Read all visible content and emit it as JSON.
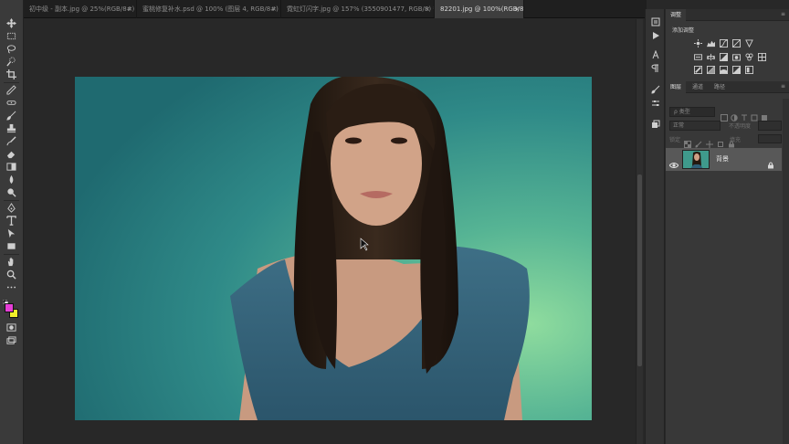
{
  "tabs": [
    {
      "label": "初中级 - 副本.jpg @ 25%(RGB/8#)",
      "close": "×",
      "active": false
    },
    {
      "label": "蜜桃修复补水.psd @ 100% (图层 4, RGB/8#) *",
      "close": "×",
      "active": false
    },
    {
      "label": "霓虹灯闪字.jpg @ 157% (3550901477, RGB/8) *",
      "close": "×",
      "active": false
    },
    {
      "label": "82201.jpg @ 100%(RGB/8#)",
      "close": "×",
      "active": true
    }
  ],
  "tools": [
    "move-tool",
    "marquee-tool",
    "lasso-tool",
    "quick-select-tool",
    "crop-tool",
    "eyedropper-tool",
    "healing-brush-tool",
    "brush-tool",
    "clone-stamp-tool",
    "history-brush-tool",
    "eraser-tool",
    "gradient-tool",
    "blur-tool",
    "dodge-tool",
    "pen-tool",
    "type-tool",
    "path-select-tool",
    "rectangle-tool",
    "hand-tool",
    "zoom-tool",
    "more-tools",
    "swap-colors",
    "color-swatches",
    "quick-mask",
    "screen-mode"
  ],
  "colors": {
    "foreground": "#e63ed6",
    "background": "#f2ef2a"
  },
  "adjustments_panel": {
    "tab": "调整",
    "title": "添加调整"
  },
  "layers_panel": {
    "tabs": [
      "图层",
      "通道",
      "路径"
    ],
    "filter_placeholder": "ρ 类型",
    "blend_mode": "正常",
    "opacity_label": "不透明度",
    "lock_label": "锁定",
    "fill_label": "填充",
    "layers": [
      {
        "name": "背景",
        "visible": true,
        "locked": true
      }
    ]
  },
  "panel_menu": "≡"
}
